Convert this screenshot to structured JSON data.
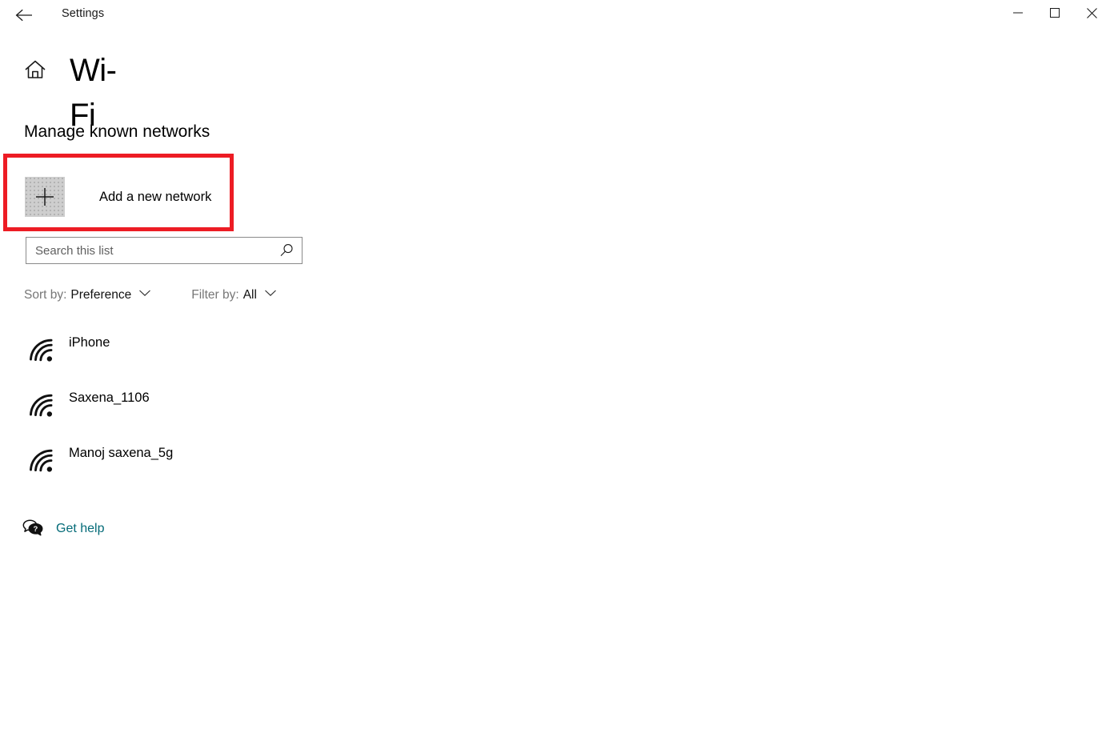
{
  "window": {
    "title": "Settings",
    "back_icon": "back-arrow-icon",
    "minimize_icon": "minimize-icon",
    "maximize_icon": "maximize-icon",
    "close_icon": "close-icon"
  },
  "page": {
    "home_icon": "home-icon",
    "title": "Wi-Fi",
    "section_heading": "Manage known networks"
  },
  "add_network": {
    "label": "Add a new network",
    "icon": "plus-icon",
    "highlight_color": "#ed1c24"
  },
  "search": {
    "placeholder": "Search this list",
    "value": "",
    "icon": "search-icon"
  },
  "sort": {
    "label": "Sort by:",
    "value": "Preference",
    "chevron_icon": "chevron-down-icon"
  },
  "filter": {
    "label": "Filter by:",
    "value": "All",
    "chevron_icon": "chevron-down-icon"
  },
  "networks": [
    {
      "name": "iPhone",
      "icon": "wifi-icon"
    },
    {
      "name": "Saxena_1106",
      "icon": "wifi-icon"
    },
    {
      "name": "Manoj saxena_5g",
      "icon": "wifi-icon"
    }
  ],
  "get_help": {
    "label": "Get help",
    "icon": "help-bubble-icon",
    "color": "#046b78"
  }
}
